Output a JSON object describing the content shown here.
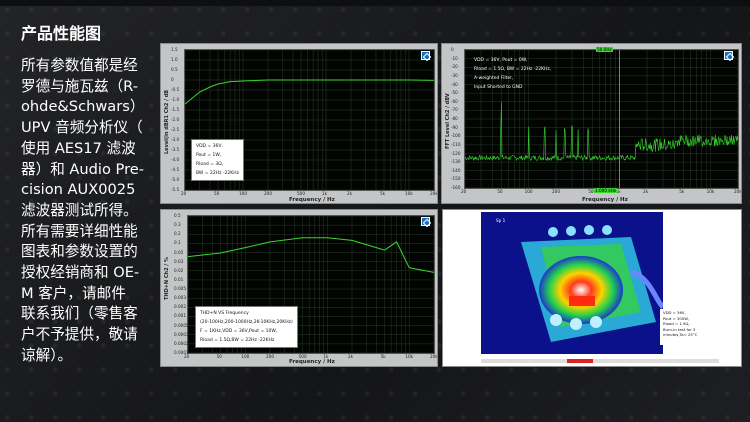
{
  "page_title": "产品性能图",
  "description_lines": [
    "所有参数值都是经",
    "罗德与施瓦兹（R-",
    "ohde&Schwars）",
    "UPV 音频分析仪（",
    "使用 AES17 滤波",
    "器）和 Audio Pre-",
    "cision AUX0025",
    "滤波器测试所得。",
    "所有需要详细性能",
    "图表和参数设置的",
    "授权经销商和 OE-",
    "M 客户，请邮件",
    "联系我们（零售客",
    "户不予提供，敬请",
    "谅解）。"
  ],
  "colors": {
    "trace": "#38d82f",
    "plot_bg": "#020402",
    "badge": "#1c6fc0"
  },
  "charts": {
    "c1": {
      "ylabel": "Level(in dBR1 Ch2 / dB",
      "xlabel": "Frequency / Hz",
      "yticks": [
        "1.5",
        "1.0",
        "0.5",
        "0",
        "-0.5",
        "-1.0",
        "-1.5",
        "-2.0",
        "-2.5",
        "-3.0",
        "-3.5",
        "-4.0",
        "-4.5",
        "-5.0",
        "-5.5"
      ],
      "xticks": [
        "20",
        "50",
        "100",
        "200",
        "500",
        "1k",
        "2k",
        "5k",
        "10k",
        "20k"
      ],
      "ann": [
        "VDD = 36V,",
        "Pout = 1W,",
        "Rload = 3Ω,",
        "BW = 22Hz -22KHz"
      ]
    },
    "c2": {
      "ylabel": "FFT Level Ch2 / dBV",
      "xlabel": "Frequency / Hz",
      "yticks": [
        "0",
        "-10",
        "-20",
        "-30",
        "-40",
        "-50",
        "-60",
        "-70",
        "-80",
        "-90",
        "-100",
        "-110",
        "-120",
        "-130",
        "-140",
        "-150",
        "-160"
      ],
      "xticks": [
        "20",
        "50",
        "100",
        "200",
        "500",
        "1k",
        "2k",
        "5k",
        "10k",
        "20k"
      ],
      "ann": [
        "VDD = 36V, Pout = 0W,",
        "Rload = 1.5Ω, BW = 22Hz -22KHz,",
        "A-weighted Filter,",
        "Input Shorted to GND"
      ],
      "marker_top": "50.0Hz",
      "marker_bottom": "1.000 kHz"
    },
    "c3": {
      "ylabel": "THD+N Ch2 / %",
      "xlabel": "Frequency / Hz",
      "yticks": [
        "0.5",
        "0.3",
        "0.2",
        "0.1",
        "0.05",
        "0.03",
        "0.02",
        "0.01",
        "0.005",
        "0.003",
        "0.002",
        "0.001",
        "0.0005",
        "0.0003",
        "0.0002",
        "0.0001"
      ],
      "xticks": [
        "20",
        "50",
        "100",
        "200",
        "500",
        "1k",
        "2k",
        "5k",
        "10k",
        "20k"
      ],
      "ann": [
        "THD+N VS  Frequency",
        "(20-100Hz,200-1000Hz,2K-10KHz,20KHz)",
        "F = 1KHz,VDD = 36V,Pout = 10W,",
        "Rload = 1.5Ω,BW = 22Hz -22KHz"
      ]
    }
  },
  "chart_data": [
    {
      "type": "line",
      "xlabel": "Frequency / Hz",
      "ylabel": "Level(in dBR1 Ch2 / dB",
      "ylim": [
        -5.5,
        1.5
      ],
      "x": [
        20,
        30,
        40,
        50,
        70,
        100,
        200,
        500,
        1000,
        2000,
        5000,
        10000,
        20000
      ],
      "values": [
        -1.2,
        -0.6,
        -0.35,
        -0.2,
        -0.08,
        -0.05,
        0,
        0,
        0,
        0,
        0,
        0,
        -0.02
      ]
    },
    {
      "type": "line",
      "xlabel": "Frequency / Hz",
      "ylabel": "FFT Level Ch2 / dBV",
      "ylim": [
        -160,
        0
      ],
      "x": [
        20,
        50,
        100,
        200,
        500,
        1000,
        2000,
        5000,
        10000,
        20000
      ],
      "values": [
        -130,
        -55,
        -128,
        -120,
        -128,
        -100,
        -115,
        -110,
        -105,
        -120
      ]
    },
    {
      "type": "line",
      "xlabel": "Frequency / Hz",
      "ylabel": "THD+N Ch2 / %",
      "ylim": [
        0.0001,
        0.5
      ],
      "x": [
        20,
        50,
        100,
        200,
        500,
        1000,
        2000,
        5000,
        7000,
        10000,
        20000
      ],
      "values": [
        0.04,
        0.05,
        0.07,
        0.1,
        0.13,
        0.13,
        0.11,
        0.06,
        0.1,
        0.02,
        0.015
      ]
    }
  ],
  "thermal": {
    "label": "Sp 1",
    "legend": [
      "VDD = 36V,",
      "Pout = 300W,",
      "Rload = 1.5Ω,",
      "Burn-in test for 3",
      "minutes,Ta= 25°C"
    ]
  }
}
